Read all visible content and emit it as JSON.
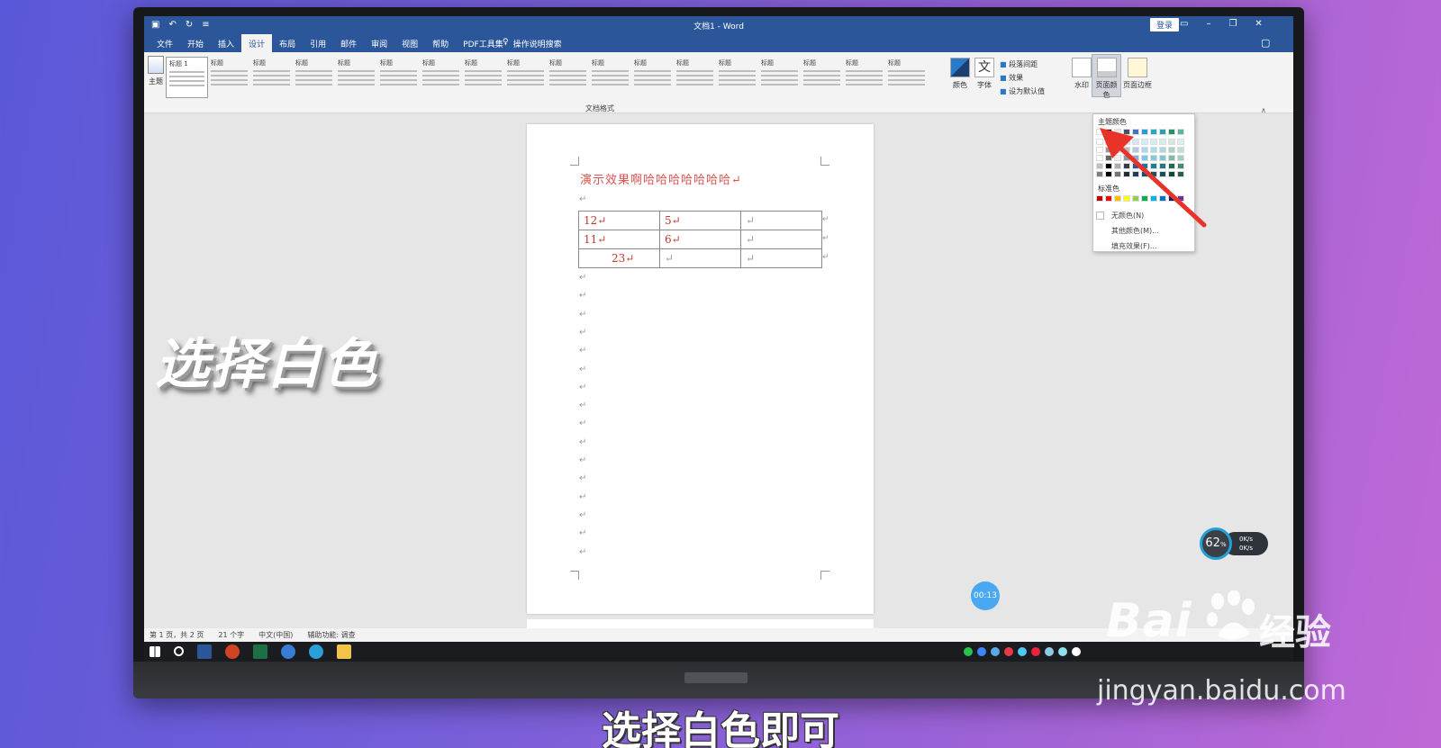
{
  "titlebar": {
    "title": "文档1  -  Word",
    "login": "登录"
  },
  "tabs": [
    {
      "label": "文件"
    },
    {
      "label": "开始"
    },
    {
      "label": "插入"
    },
    {
      "label": "设计",
      "active": true
    },
    {
      "label": "布局"
    },
    {
      "label": "引用"
    },
    {
      "label": "邮件"
    },
    {
      "label": "审阅"
    },
    {
      "label": "视图"
    },
    {
      "label": "帮助"
    },
    {
      "label": "PDF工具集"
    }
  ],
  "search": {
    "label": "操作说明搜索"
  },
  "ribbon": {
    "theme": "主题",
    "style_sample_label": "标题",
    "style_first_label": "标题 1",
    "styles_caption": "文档格式",
    "colors": "颜色",
    "fonts": "字体",
    "para_spacing": "段落间距",
    "effects": "效果",
    "set_default": "设为默认值",
    "watermark": "水印",
    "page_color": "页面颜色",
    "page_borders": "页面边框"
  },
  "document": {
    "heading": "演示效果啊哈哈哈哈哈哈哈↵",
    "para_mark": "↵",
    "table": [
      [
        "12↵",
        "5↵",
        "↵"
      ],
      [
        "11↵",
        "6↵",
        "↵"
      ],
      [
        "23↵",
        "↵",
        "↵"
      ]
    ]
  },
  "palette": {
    "theme_title": "主题颜色",
    "standard_title": "标准色",
    "no_color": "无颜色(N)",
    "more_colors": "其他颜色(M)...",
    "fill_effects": "填充效果(F)...",
    "theme_colors": [
      "#ffffff",
      "#000000",
      "#e7e6e6",
      "#44546a",
      "#4472c4",
      "#21a0d2",
      "#27a9c2",
      "#2f9fae",
      "#2e8b6a",
      "#5ab5a0"
    ],
    "standard_colors": [
      "#c00000",
      "#ff0000",
      "#ffc000",
      "#ffff00",
      "#92d050",
      "#00b050",
      "#00b0f0",
      "#0070c0",
      "#002060",
      "#7030a0"
    ]
  },
  "status": {
    "page": "第 1 页，共 2 页",
    "words": "21 个字",
    "lang": "中文(中国)",
    "accessibility": "辅助功能: 调查"
  },
  "overlay": {
    "side_caption": "选择白色",
    "subtitle": "选择白色即可",
    "timer": "00:13",
    "speed_percent": "62",
    "speed_up": "0K/s",
    "speed_down": "0K/s"
  },
  "watermark": {
    "logo": "Bai",
    "logo_cn": "经验",
    "url": "jingyan.baidu.com"
  },
  "accent_colors": {
    "word_blue": "#2b579a",
    "doc_red": "#d9534f",
    "arrow_red": "#e8332a"
  }
}
